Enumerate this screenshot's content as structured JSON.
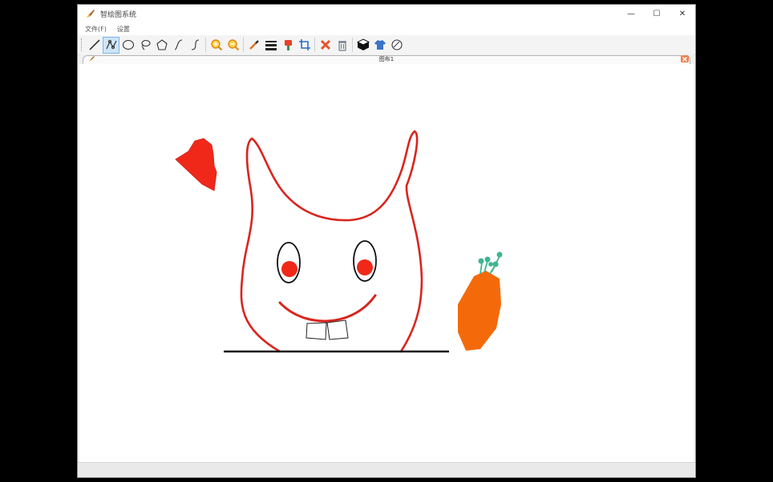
{
  "window": {
    "title": "智绘图系统",
    "controls": {
      "minimize": "—",
      "maximize": "☐",
      "close": "✕"
    }
  },
  "menu": [
    {
      "label": "文件(F)"
    },
    {
      "label": "设置"
    }
  ],
  "toolbar": {
    "tools": [
      {
        "icon": "line-tool-icon"
      },
      {
        "icon": "polyline-tool-icon",
        "active": true
      },
      {
        "icon": "ellipse-tool-icon"
      },
      {
        "icon": "lasso-tool-icon"
      },
      {
        "icon": "polygon-tool-icon"
      },
      {
        "icon": "curve-tool-icon"
      },
      {
        "icon": "bezier-tool-icon"
      },
      {
        "icon": "zoom-in-icon"
      },
      {
        "icon": "zoom-out-icon"
      },
      {
        "icon": "color-picker-icon"
      },
      {
        "icon": "line-width-icon"
      },
      {
        "icon": "fill-bucket-icon"
      },
      {
        "icon": "crop-icon"
      },
      {
        "icon": "delete-icon"
      },
      {
        "icon": "trash-icon"
      },
      {
        "icon": "cube-icon"
      },
      {
        "icon": "shirt-icon"
      },
      {
        "icon": "eraser-icon"
      }
    ]
  },
  "document": {
    "tab_title": "图布1"
  },
  "colors": {
    "outline_red": "#d9251e",
    "fill_red": "#f0281a",
    "carrot_orange": "#f46a0a",
    "carrot_leaf": "#3fb58f",
    "accent_zoom": "#f0a020",
    "close_red": "#e8542a"
  }
}
